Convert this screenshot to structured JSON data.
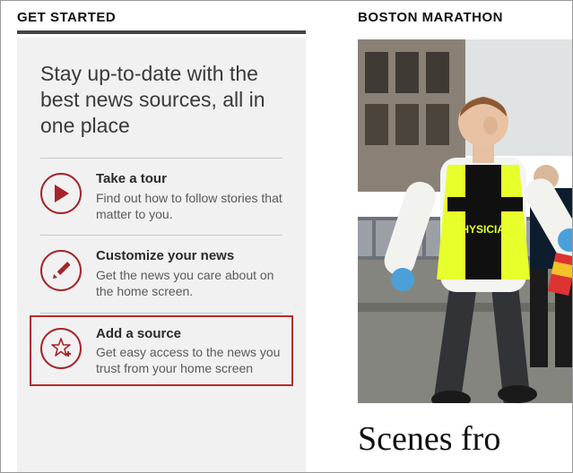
{
  "left": {
    "section_title": "GET STARTED",
    "intro": "Stay up-to-date with the best news sources, all in one place",
    "actions": [
      {
        "title": "Take a tour",
        "desc": "Find out how to follow stories that matter to you."
      },
      {
        "title": "Customize your news",
        "desc": "Get the news you care about on the home screen."
      },
      {
        "title": "Add a source",
        "desc": "Get easy access to the news you trust from your home screen"
      }
    ]
  },
  "right": {
    "section_title": "BOSTON MARATHON",
    "story_headline": "Scenes fro"
  },
  "colors": {
    "accent": "#a6242b",
    "highlight_border": "#b72c2c"
  }
}
